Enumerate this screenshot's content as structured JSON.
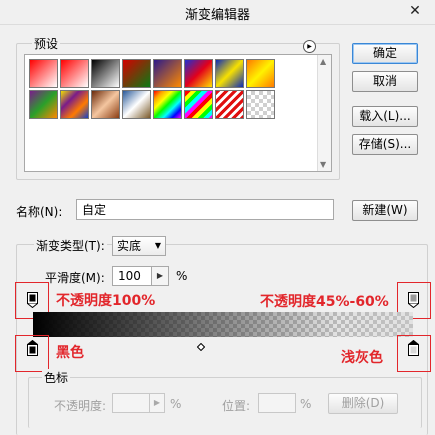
{
  "window": {
    "title": "渐变编辑器",
    "close_glyph": "✕"
  },
  "presets": {
    "label": "预设",
    "swatches": [
      {
        "name": "fg-to-bg",
        "bg": "linear-gradient(135deg,#ff0000,#ffffff)"
      },
      {
        "name": "fg-to-transparent",
        "bg": "linear-gradient(135deg,#ff0000 0%,rgba(255,0,0,0) 100%)"
      },
      {
        "name": "black-white",
        "bg": "linear-gradient(135deg,#000,#fff)"
      },
      {
        "name": "red-green",
        "bg": "linear-gradient(135deg,#d40000,#0a7a14)"
      },
      {
        "name": "violet-orange",
        "bg": "linear-gradient(135deg,#2b1a8a,#ff8a00)"
      },
      {
        "name": "blue-red-yellow",
        "bg": "linear-gradient(135deg,#1f2fd1,#e3001b,#ffe200)"
      },
      {
        "name": "blue-yellow-blue",
        "bg": "linear-gradient(135deg,#0c2bb8,#f7e100,#0c2bb8)"
      },
      {
        "name": "orange-yellow-orange",
        "bg": "linear-gradient(135deg,#ff7a00,#fff200,#ff7a00)"
      },
      {
        "name": "violet-green-orange",
        "bg": "linear-gradient(135deg,#7a1c8a,#2aa02a,#ff8800)"
      },
      {
        "name": "yellow-violet-orange-blue",
        "bg": "linear-gradient(135deg,#f0e000,#7a1c8a,#ff7a00,#1640c8)"
      },
      {
        "name": "copper",
        "bg": "linear-gradient(135deg,#6b2a0a,#f4c6a0,#8a3c12)"
      },
      {
        "name": "chrome",
        "bg": "linear-gradient(135deg,#2a5a9a,#ffffff,#7a5a2a)"
      },
      {
        "name": "spectrum",
        "bg": "linear-gradient(135deg,red,orange,yellow,lime,cyan,blue,magenta)"
      },
      {
        "name": "transparent-rainbow",
        "bg": "repeating-linear-gradient(135deg,red 0 4px,yellow 4px 8px,lime 8px 12px,cyan 12px 16px,magenta 16px 20px)"
      },
      {
        "name": "transparent-stripes",
        "bg": "repeating-linear-gradient(135deg,#e01010 0 3px,#ffffff 3px 6px)"
      },
      {
        "name": "neutral-density",
        "bg": "repeating-conic-gradient(#d0d0d0 0% 25%,#ffffff 0% 50%) 0 0/8px 8px"
      }
    ]
  },
  "buttons": {
    "ok": "确定",
    "cancel": "取消",
    "load": "载入(L)...",
    "save": "存储(S)...",
    "new": "新建(W)"
  },
  "name_field": {
    "label": "名称(N):",
    "value": "自定"
  },
  "gradient_type": {
    "label": "渐变类型(T):",
    "value": "实底"
  },
  "smoothness": {
    "label": "平滑度(M):",
    "value": "100",
    "unit": "%"
  },
  "annotations": {
    "left_opacity": "不透明度100%",
    "right_opacity": "不透明度45%-60%",
    "left_color": "黑色",
    "right_color": "浅灰色"
  },
  "stops_group": {
    "label": "色标",
    "opacity_label": "不透明度:",
    "percent": "%",
    "location_label": "位置:",
    "delete": "删除(D)"
  },
  "colors": {
    "annotation_red": "#e2262b",
    "left_color_stop": "#000000",
    "right_color_stop": "#d8d8d8"
  }
}
